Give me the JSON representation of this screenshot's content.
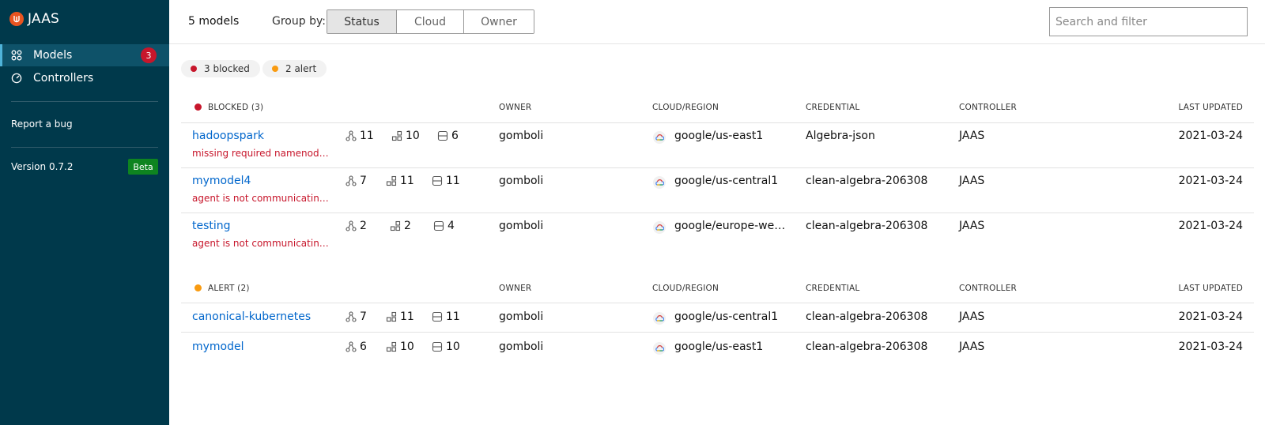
{
  "app": {
    "name": "JAAS"
  },
  "sidebar": {
    "items": [
      {
        "label": "Models",
        "badge": "3"
      },
      {
        "label": "Controllers"
      }
    ],
    "report_bug": "Report a bug",
    "version": "Version 0.7.2",
    "beta": "Beta"
  },
  "header": {
    "count": "5 models",
    "group_by_label": "Group by:",
    "group_options": [
      "Status",
      "Cloud",
      "Owner"
    ],
    "selected_group": "Status",
    "search_placeholder": "Search and filter"
  },
  "chips": [
    {
      "label": "3 blocked",
      "color": "#c7162b"
    },
    {
      "label": "2 alert",
      "color": "#f99b11"
    }
  ],
  "columns": {
    "owner": "OWNER",
    "cloud": "CLOUD/REGION",
    "credential": "CREDENTIAL",
    "controller": "CONTROLLER",
    "updated": "LAST UPDATED"
  },
  "groups": [
    {
      "title": "BLOCKED (3)",
      "color": "#c7162b",
      "rows": [
        {
          "name": "hadoopspark",
          "message": "missing required namenod…",
          "apps": "11",
          "units": "10",
          "machines": "6",
          "owner": "gomboli",
          "cloud": "google/us-east1",
          "credential": "Algebra-json",
          "controller": "JAAS",
          "updated": "2021-03-24"
        },
        {
          "name": "mymodel4",
          "message": "agent is not communicatin…",
          "apps": "7",
          "units": "11",
          "machines": "11",
          "owner": "gomboli",
          "cloud": "google/us-central1",
          "credential": "clean-algebra-206308",
          "controller": "JAAS",
          "updated": "2021-03-24"
        },
        {
          "name": "testing",
          "message": "agent is not communicatin…",
          "apps": "2",
          "units": "2",
          "machines": "4",
          "owner": "gomboli",
          "cloud": "google/europe-we…",
          "credential": "clean-algebra-206308",
          "controller": "JAAS",
          "updated": "2021-03-24"
        }
      ]
    },
    {
      "title": "ALERT (2)",
      "color": "#f99b11",
      "rows": [
        {
          "name": "canonical-kubernetes",
          "apps": "7",
          "units": "11",
          "machines": "11",
          "owner": "gomboli",
          "cloud": "google/us-central1",
          "credential": "clean-algebra-206308",
          "controller": "JAAS",
          "updated": "2021-03-24"
        },
        {
          "name": "mymodel",
          "apps": "6",
          "units": "10",
          "machines": "10",
          "owner": "gomboli",
          "cloud": "google/us-east1",
          "credential": "clean-algebra-206308",
          "controller": "JAAS",
          "updated": "2021-03-24"
        }
      ]
    }
  ]
}
